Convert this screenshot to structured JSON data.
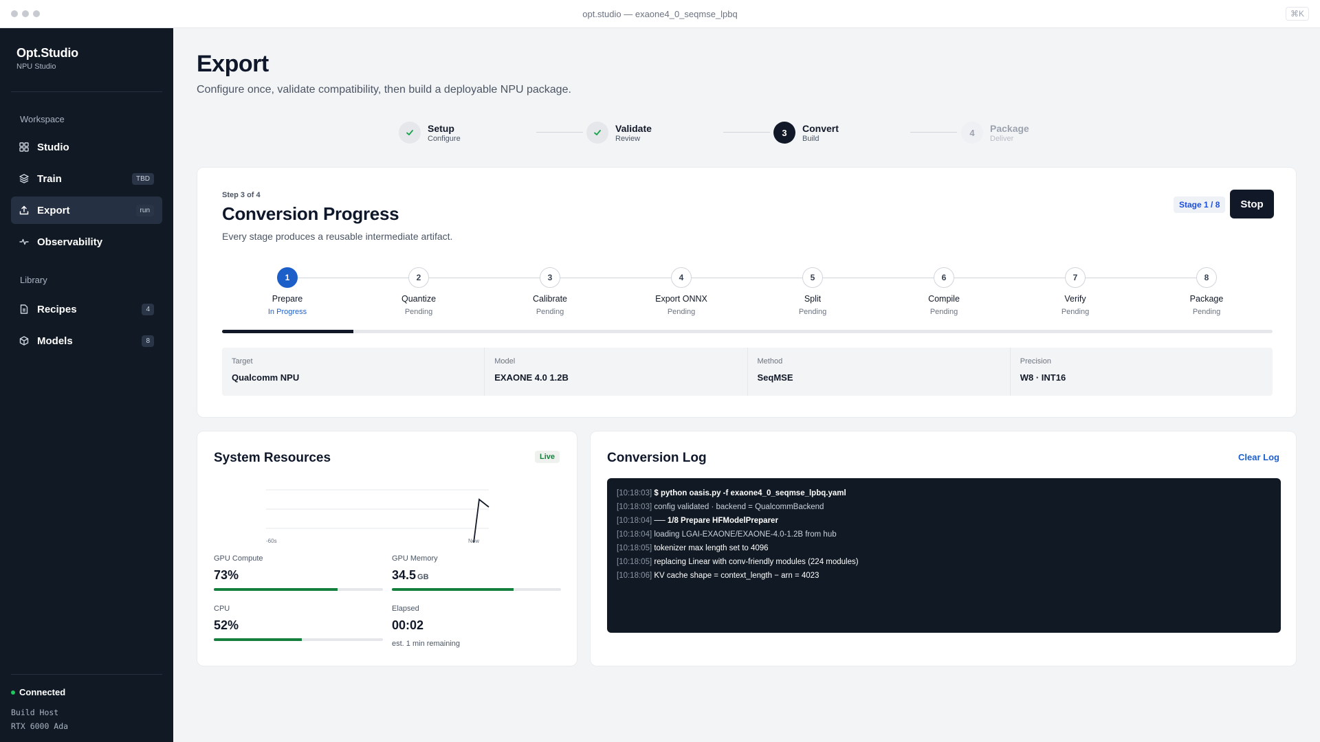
{
  "window": {
    "title": "opt.studio — exaone4_0_seqmse_lpbq",
    "shortcut": "⌘K"
  },
  "sidebar": {
    "brand": "Opt.Studio",
    "brand_sub": "NPU Studio",
    "sections": {
      "workspace": "Workspace",
      "library": "Library"
    },
    "items": [
      {
        "label": "Studio",
        "icon": "grid-icon",
        "badge": ""
      },
      {
        "label": "Train",
        "icon": "layers-icon",
        "badge": "TBD"
      },
      {
        "label": "Export",
        "icon": "upload-icon",
        "badge": "run",
        "active": true
      },
      {
        "label": "Observability",
        "icon": "activity-icon",
        "badge": ""
      },
      {
        "label": "Recipes",
        "icon": "document-icon",
        "badge": "4"
      },
      {
        "label": "Models",
        "icon": "cube-icon",
        "badge": "8"
      }
    ],
    "status": {
      "label": "Connected",
      "host_label": "Build Host",
      "host_value": "RTX 6000 Ada"
    }
  },
  "page": {
    "title": "Export",
    "subtitle": "Configure once, validate compatibility, then build a deployable NPU package."
  },
  "stepper": [
    {
      "num": "1",
      "title": "Setup",
      "sub": "Configure",
      "state": "done"
    },
    {
      "num": "2",
      "title": "Validate",
      "sub": "Review",
      "state": "done"
    },
    {
      "num": "3",
      "title": "Convert",
      "sub": "Build",
      "state": "current"
    },
    {
      "num": "4",
      "title": "Package",
      "sub": "Deliver",
      "state": "future"
    }
  ],
  "progress": {
    "eyebrow": "Step 3 of 4",
    "title": "Conversion Progress",
    "subtitle": "Every stage produces a reusable intermediate artifact.",
    "stage_pill": "Stage 1 / 8",
    "stop_label": "Stop",
    "fraction": 0.125,
    "stages": [
      {
        "num": "1",
        "name": "Prepare",
        "status": "In Progress"
      },
      {
        "num": "2",
        "name": "Quantize",
        "status": "Pending"
      },
      {
        "num": "3",
        "name": "Calibrate",
        "status": "Pending"
      },
      {
        "num": "4",
        "name": "Export ONNX",
        "status": "Pending"
      },
      {
        "num": "5",
        "name": "Split",
        "status": "Pending"
      },
      {
        "num": "6",
        "name": "Compile",
        "status": "Pending"
      },
      {
        "num": "7",
        "name": "Verify",
        "status": "Pending"
      },
      {
        "num": "8",
        "name": "Package",
        "status": "Pending"
      }
    ],
    "info": [
      {
        "label": "Target",
        "value": "Qualcomm NPU"
      },
      {
        "label": "Model",
        "value": "EXAONE 4.0 1.2B"
      },
      {
        "label": "Method",
        "value": "SeqMSE"
      },
      {
        "label": "Precision",
        "value": "W8 · INT16"
      }
    ]
  },
  "resources": {
    "title": "System Resources",
    "live": "Live",
    "chart": {
      "x_start": "-60s",
      "x_end": "Now"
    },
    "gpu_compute": {
      "label": "GPU Compute",
      "value": "73%",
      "fraction": 0.73
    },
    "gpu_memory": {
      "label": "GPU Memory",
      "value": "34.5",
      "unit": "GB",
      "fraction": 0.72
    },
    "cpu": {
      "label": "CPU",
      "value": "52%",
      "fraction": 0.52
    },
    "elapsed": {
      "label": "Elapsed",
      "value": "00:02",
      "note": "est. 1 min remaining"
    }
  },
  "log": {
    "title": "Conversion Log",
    "clear_label": "Clear Log",
    "lines": [
      {
        "ts": "[10:18:03]",
        "msg": "$ python oasis.py -f exaone4_0_seqmse_lpbq.yaml",
        "style": "bold"
      },
      {
        "ts": "[10:18:03]",
        "msg": "config validated · backend = QualcommBackend",
        "style": "normal"
      },
      {
        "ts": "[10:18:04]",
        "msg": "── 1/8 Prepare HFModelPreparer",
        "style": "bold"
      },
      {
        "ts": "[10:18:04]",
        "msg": "loading LGAI-EXAONE/EXAONE-4.0-1.2B from hub",
        "style": "normal"
      },
      {
        "ts": "[10:18:05]",
        "msg": "tokenizer max length set to 4096",
        "style": "white"
      },
      {
        "ts": "[10:18:05]",
        "msg": "replacing Linear with conv-friendly modules (224 modules)",
        "style": "white"
      },
      {
        "ts": "[10:18:06]",
        "msg": "KV cache shape = context_length − arn = 4023",
        "style": "white"
      }
    ]
  }
}
